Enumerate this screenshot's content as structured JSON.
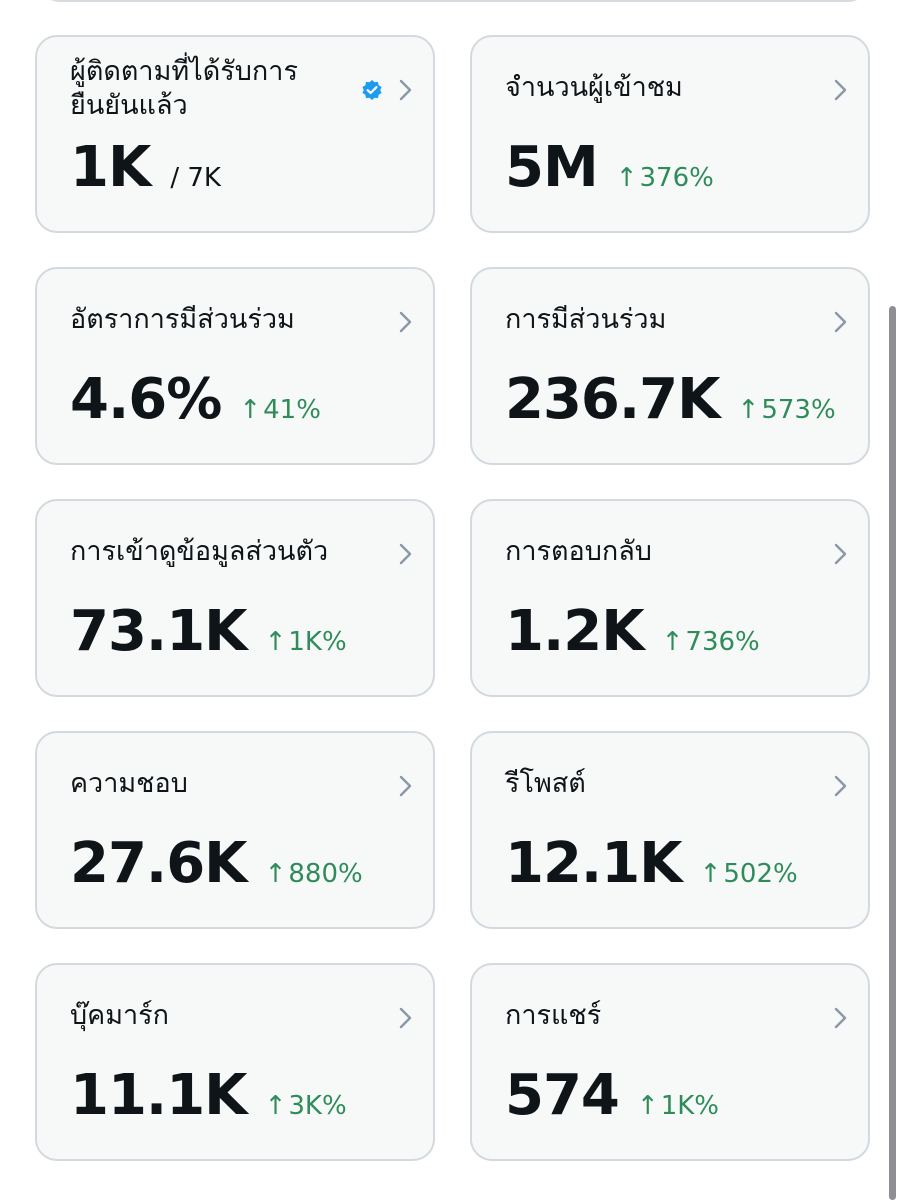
{
  "cards": [
    {
      "title": "ผู้ติดตามที่ได้รับการยืนยันแล้ว",
      "value": "1K",
      "total": "/ 7K"
    },
    {
      "title": "จำนวนผู้เข้าชม",
      "value": "5M",
      "change": "376%"
    },
    {
      "title": "อัตราการมีส่วนร่วม",
      "value": "4.6%",
      "change": "41%"
    },
    {
      "title": "การมีส่วนร่วม",
      "value": "236.7K",
      "change": "573%"
    },
    {
      "title": "การเข้าดูข้อมูลส่วนตัว",
      "value": "73.1K",
      "change": "1K%"
    },
    {
      "title": "การตอบกลับ",
      "value": "1.2K",
      "change": "736%"
    },
    {
      "title": "ความชอบ",
      "value": "27.6K",
      "change": "880%"
    },
    {
      "title": "รีโพสต์",
      "value": "12.1K",
      "change": "502%"
    },
    {
      "title": "บุ๊คมาร์ก",
      "value": "11.1K",
      "change": "3K%"
    },
    {
      "title": "การแชร์",
      "value": "574",
      "change": "1K%"
    }
  ],
  "symbols": {
    "arrow_up": "↑"
  },
  "colors": {
    "accent_positive": "#2f8c5a",
    "verified": "#1d9bf0",
    "chevron": "#8b98a5"
  },
  "icons": [
    "verified-badge-icon",
    "chevron-right-icon",
    "arrow-up-icon"
  ]
}
